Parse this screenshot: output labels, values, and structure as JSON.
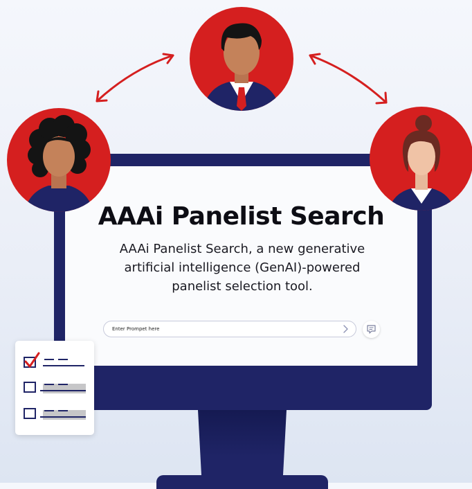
{
  "headline": "AAAi Panelist Search",
  "description": "AAAi Panelist Search, a new generative artificial intelligence (GenAI)-powered panelist selection tool.",
  "search": {
    "placeholder": "Enter Prompet here",
    "value": ""
  },
  "icons": {
    "send": "chevron-right-icon",
    "chat": "chat-icon"
  },
  "colors": {
    "accent_red": "#d51f1f",
    "monitor_navy": "#1f2466",
    "skin": "#c4825a"
  }
}
